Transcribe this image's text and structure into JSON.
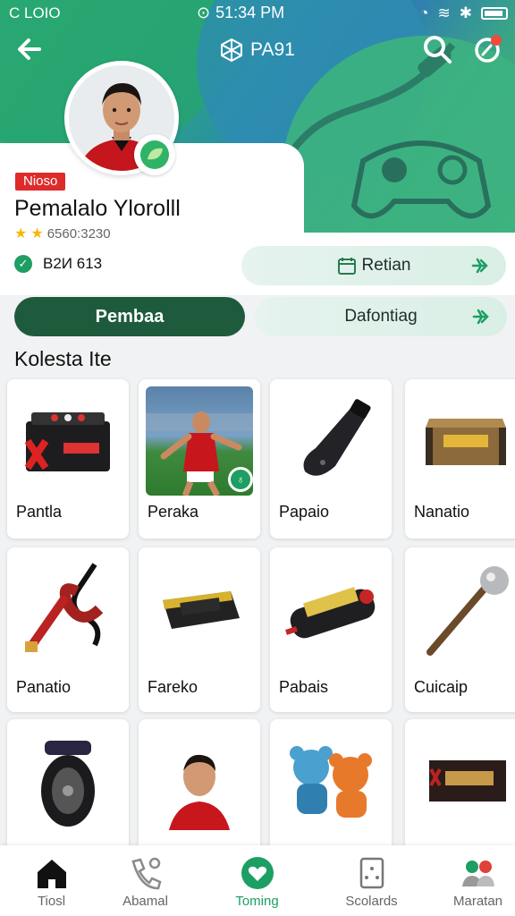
{
  "status": {
    "carrier": "C LOIO",
    "time": "51:34 PM"
  },
  "header": {
    "title": "PA91"
  },
  "profile": {
    "tag": "Nioso",
    "name": "Pemalalo Ylorolll",
    "rating_text": "6560:3230",
    "stars": 2,
    "verified_id": "B2И 613"
  },
  "actions": {
    "retian": "Retian",
    "primary": "Pembaa",
    "secondary": "Dafontiag"
  },
  "section_title": "Kolesta Ite",
  "items": [
    {
      "label": "Pantla",
      "icon": "toolbox-icon"
    },
    {
      "label": "Peraka",
      "icon": "soccer-player-photo"
    },
    {
      "label": "Papaio",
      "icon": "funnel-icon"
    },
    {
      "label": "Nanatio",
      "icon": "chest-icon"
    },
    {
      "label": "Panatio",
      "icon": "hose-tool-icon"
    },
    {
      "label": "Fareko",
      "icon": "gold-case-icon"
    },
    {
      "label": "Pabais",
      "icon": "canister-icon"
    },
    {
      "label": "Cuicaip",
      "icon": "mace-icon"
    },
    {
      "label": "",
      "icon": "wheel-icon"
    },
    {
      "label": "",
      "icon": "player-portrait-icon"
    },
    {
      "label": "",
      "icon": "bear-toys-icon"
    },
    {
      "label": "",
      "icon": "crate-icon"
    }
  ],
  "nav": [
    {
      "label": "Tiosl",
      "icon": "home-icon"
    },
    {
      "label": "Abamal",
      "icon": "phone-icon"
    },
    {
      "label": "Toming",
      "icon": "heart-icon"
    },
    {
      "label": "Scolards",
      "icon": "card-icon"
    },
    {
      "label": "Maratan",
      "icon": "people-icon"
    }
  ],
  "colors": {
    "accent": "#1d9e62",
    "primary_button": "#1e5b3c",
    "tag": "#dd2b2b"
  }
}
